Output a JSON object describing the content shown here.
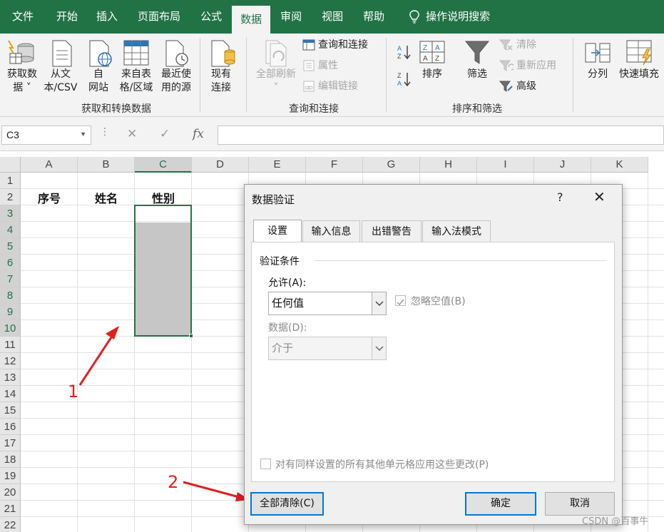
{
  "menu": {
    "tabs": [
      "文件",
      "开始",
      "插入",
      "页面布局",
      "公式",
      "数据",
      "审阅",
      "视图",
      "帮助"
    ],
    "active_tab": "数据",
    "search_label": "操作说明搜索"
  },
  "ribbon": {
    "get_data": "获取数\n据 ˅",
    "from_csv": "从文\n本/CSV",
    "from_web": "自\n网站",
    "from_table": "来自表\n格/区域",
    "recent_sources": "最近使\n用的源",
    "existing_conn": "现有\n连接",
    "group_get": "获取和转换数据",
    "refresh_all": "全部刷新\n˅",
    "queries_connections": "查询和连接",
    "properties": "属性",
    "edit_links": "编辑链接",
    "group_queries": "查询和连接",
    "sort": "排序",
    "filter": "筛选",
    "clear": "清除",
    "reapply": "重新应用",
    "advanced": "高级",
    "group_sort": "排序和筛选",
    "text_to_columns": "分列",
    "flash_fill": "快速填充"
  },
  "formula_bar": {
    "name_box": "C3",
    "fx": "fx",
    "value": ""
  },
  "grid": {
    "columns": [
      "A",
      "B",
      "C",
      "D",
      "E",
      "F",
      "G",
      "H",
      "I",
      "J",
      "K"
    ],
    "rows": [
      "1",
      "2",
      "3",
      "4",
      "5",
      "6",
      "7",
      "8",
      "9",
      "10",
      "11",
      "12",
      "13",
      "14",
      "15",
      "16",
      "17",
      "18",
      "19",
      "20",
      "21",
      "22"
    ],
    "header_cells": [
      "序号",
      "姓名",
      "性别"
    ]
  },
  "dialog": {
    "title": "数据验证",
    "help": "?",
    "close": "✕",
    "tabs": [
      "设置",
      "输入信息",
      "出错警告",
      "输入法模式"
    ],
    "section_label": "验证条件",
    "allow_label": "允许(A):",
    "allow_value": "任何值",
    "ignore_blank_label": "忽略空值(B)",
    "data_label": "数据(D):",
    "data_value": "介于",
    "apply_all_label": "对有同样设置的所有其他单元格应用这些更改(P)",
    "clear_all_button": "全部清除(C)",
    "ok_button": "确定",
    "cancel_button": "取消"
  },
  "annotations": {
    "label_1": "1",
    "label_2": "2",
    "accent_color": "#e02020"
  },
  "watermark": "CSDN @百事牛",
  "colors": {
    "excel_green": "#217346",
    "selection_fill": "#c6c6c6"
  }
}
